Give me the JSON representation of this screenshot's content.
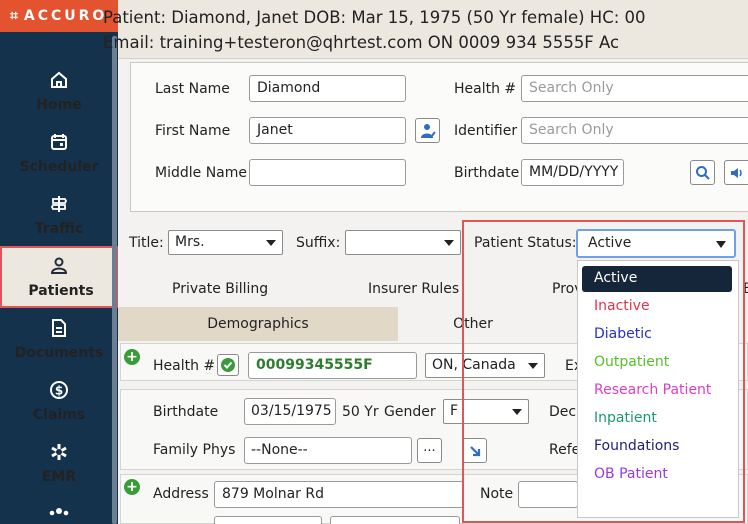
{
  "brand": {
    "mark": "⌗",
    "name": "ACCURO"
  },
  "nav": [
    {
      "label": "Home",
      "icon": "home-icon"
    },
    {
      "label": "Scheduler",
      "icon": "calendar-icon"
    },
    {
      "label": "Traffic",
      "icon": "signpost-icon"
    },
    {
      "label": "Patients",
      "icon": "person-icon"
    },
    {
      "label": "Documents",
      "icon": "document-icon"
    },
    {
      "label": "Claims",
      "icon": "dollar-icon"
    },
    {
      "label": "EMR",
      "icon": "medical-icon"
    }
  ],
  "header": {
    "line1": "Patient: Diamond, Janet DOB: Mar 15, 1975 (50 Yr female) HC: 00",
    "line2": "Email: training+testeron@qhrtest.com ON 0009 934 5555F Ac"
  },
  "search": {
    "last_name_label": "Last Name",
    "last_name": "Diamond",
    "first_name_label": "First Name",
    "first_name": "Janet",
    "middle_name_label": "Middle Name",
    "middle_name": "",
    "health_label": "Health #",
    "health_placeholder": "Search Only",
    "identifier_label": "Identifier",
    "identifier_placeholder": "Search Only",
    "birthdate_label": "Birthdate",
    "birthdate_placeholder": "MM/DD/YYYY"
  },
  "form": {
    "title_label": "Title:",
    "title_value": "Mrs.",
    "suffix_label": "Suffix:",
    "suffix_value": "",
    "status_label": "Patient Status:",
    "status_value": "Active",
    "links": [
      "Private Billing",
      "Insurer Rules",
      "Prov",
      "E"
    ]
  },
  "tabs": [
    {
      "label": "Demographics"
    },
    {
      "label": "Other"
    }
  ],
  "demographics": {
    "health_label": "Health #",
    "health_value": "00099345555F",
    "province": "ON, Canada",
    "exp_label": "Ex",
    "birthdate_label": "Birthdate",
    "birthdate": "03/15/1975",
    "age": "50 Yr",
    "gender_label": "Gender",
    "gender": "F",
    "dec_label": "Dec",
    "family_phys_label": "Family Phys",
    "family_phys": "--None--",
    "browse": "...",
    "ref_label": "Refe",
    "address_label": "Address",
    "address": "879 Molnar Rd",
    "note_label": "Note"
  },
  "status_options": [
    {
      "label": "Active",
      "color": "#ffffff",
      "selected": true
    },
    {
      "label": "Inactive",
      "color": "#e0344a"
    },
    {
      "label": "Diabetic",
      "color": "#2830c8"
    },
    {
      "label": "Outpatient",
      "color": "#56c028"
    },
    {
      "label": "Research Patient",
      "color": "#e03cc8"
    },
    {
      "label": "Inpatient",
      "color": "#1a9a6a"
    },
    {
      "label": "Foundations",
      "color": "#1e1e78"
    },
    {
      "label": "OB Patient",
      "color": "#9a38e0"
    }
  ],
  "colors": {
    "sidebar": "#15324d",
    "brand": "#e4532f",
    "highlight": "#e05555",
    "selected_option": "#15263a",
    "health_green": "#2e7d2e"
  }
}
